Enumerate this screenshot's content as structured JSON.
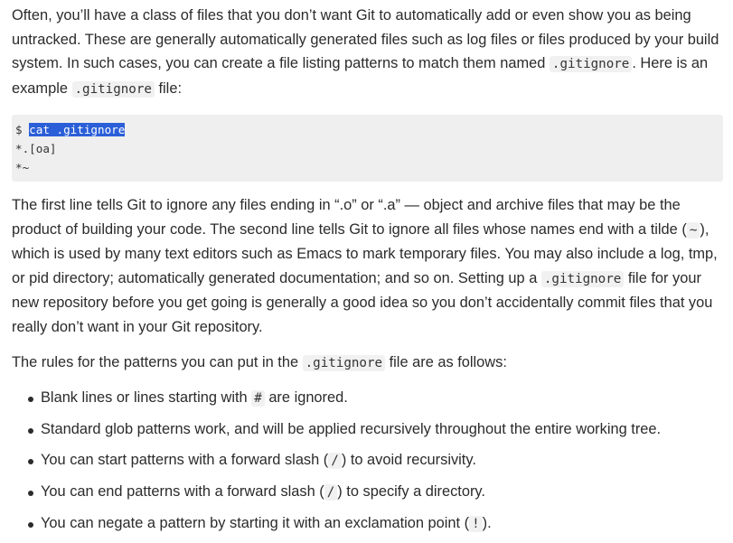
{
  "para1": {
    "t1": "Often, you’ll have a class of files that you don’t want Git to automatically add or even show you as being untracked. These are generally automatically generated files such as log files or files produced by your build system. In such cases, you can create a file listing patterns to match them named ",
    "c1": ".gitignore",
    "t2": ". Here is an example ",
    "c2": ".gitignore",
    "t3": " file:"
  },
  "codeblock": {
    "prompt": "$ ",
    "command": "cat .gitignore",
    "line2": "*.[oa]",
    "line3": "*~"
  },
  "para2": {
    "t1": "The first line tells Git to ignore any files ending in “.o” or “.a” — object and archive files that may be the product of building your code. The second line tells Git to ignore all files whose names end with a tilde (",
    "c1": "~",
    "t2": "), which is used by many text editors such as Emacs to mark temporary files. You may also include a log, tmp, or pid directory; automatically generated documentation; and so on. Setting up a ",
    "c2": ".gitignore",
    "t3": " file for your new repository before you get going is generally a good idea so you don’t accidentally commit files that you really don’t want in your Git repository."
  },
  "para3": {
    "t1": "The rules for the patterns you can put in the ",
    "c1": ".gitignore",
    "t2": " file are as follows:"
  },
  "rules": [
    {
      "t1": "Blank lines or lines starting with ",
      "c1": "#",
      "t2": " are ignored."
    },
    {
      "t1": "Standard glob patterns work, and will be applied recursively throughout the entire working tree.",
      "c1": "",
      "t2": ""
    },
    {
      "t1": "You can start patterns with a forward slash (",
      "c1": "/",
      "t2": ") to avoid recursivity."
    },
    {
      "t1": "You can end patterns with a forward slash (",
      "c1": "/",
      "t2": ") to specify a directory."
    },
    {
      "t1": "You can negate a pattern by starting it with an exclamation point (",
      "c1": "!",
      "t2": ")."
    }
  ]
}
